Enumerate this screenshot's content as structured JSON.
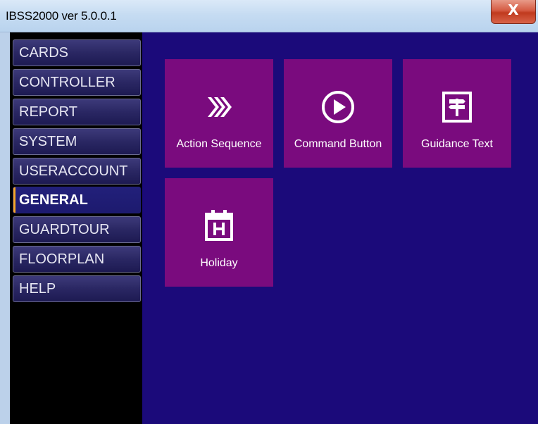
{
  "window": {
    "title": "IBSS2000 ver 5.0.0.1",
    "close_glyph": "X"
  },
  "sidebar": {
    "items": [
      {
        "label": "CARDS"
      },
      {
        "label": "CONTROLLER"
      },
      {
        "label": "REPORT"
      },
      {
        "label": "SYSTEM"
      },
      {
        "label": "USERACCOUNT"
      },
      {
        "label": "GENERAL",
        "active": true
      },
      {
        "label": "GUARDTOUR"
      },
      {
        "label": "FLOORPLAN"
      },
      {
        "label": "HELP"
      }
    ]
  },
  "tiles": [
    {
      "label": "Action Sequence",
      "icon": "double-chevron-right-icon"
    },
    {
      "label": "Command Button",
      "icon": "play-circle-icon"
    },
    {
      "label": "Guidance Text",
      "icon": "signpost-icon"
    },
    {
      "label": "Holiday",
      "icon": "calendar-h-icon"
    }
  ],
  "colors": {
    "content_background": "#1b0a7a",
    "tile_background": "#7a0b7e",
    "sidebar_background": "#000000",
    "active_indicator": "#f5a623"
  }
}
